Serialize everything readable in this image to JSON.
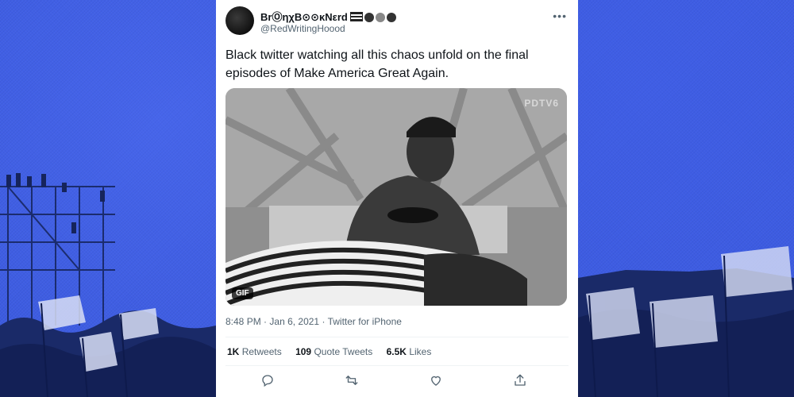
{
  "tweet": {
    "display_name": "BrⓄηχB⊙⊙κNεrd",
    "handle": "@RedWritingHoood",
    "text": "Black twitter watching all this chaos unfold on the final episodes of Make America Great Again.",
    "more_label": "•••",
    "media": {
      "watermark": "PDTV6",
      "badge": "GIF"
    },
    "time": "8:48 PM",
    "date": "Jan 6, 2021",
    "source": "Twitter for iPhone",
    "stats": {
      "retweets_value": "1K",
      "retweets_label": "Retweets",
      "quotes_value": "109",
      "quotes_label": "Quote Tweets",
      "likes_value": "6.5K",
      "likes_label": "Likes"
    }
  },
  "colors": {
    "background": "#3c5be0",
    "card": "#ffffff",
    "text": "#0f1419",
    "secondary": "#536471"
  },
  "icons": [
    "reply-icon",
    "retweet-icon",
    "like-icon",
    "share-icon",
    "more-icon"
  ]
}
